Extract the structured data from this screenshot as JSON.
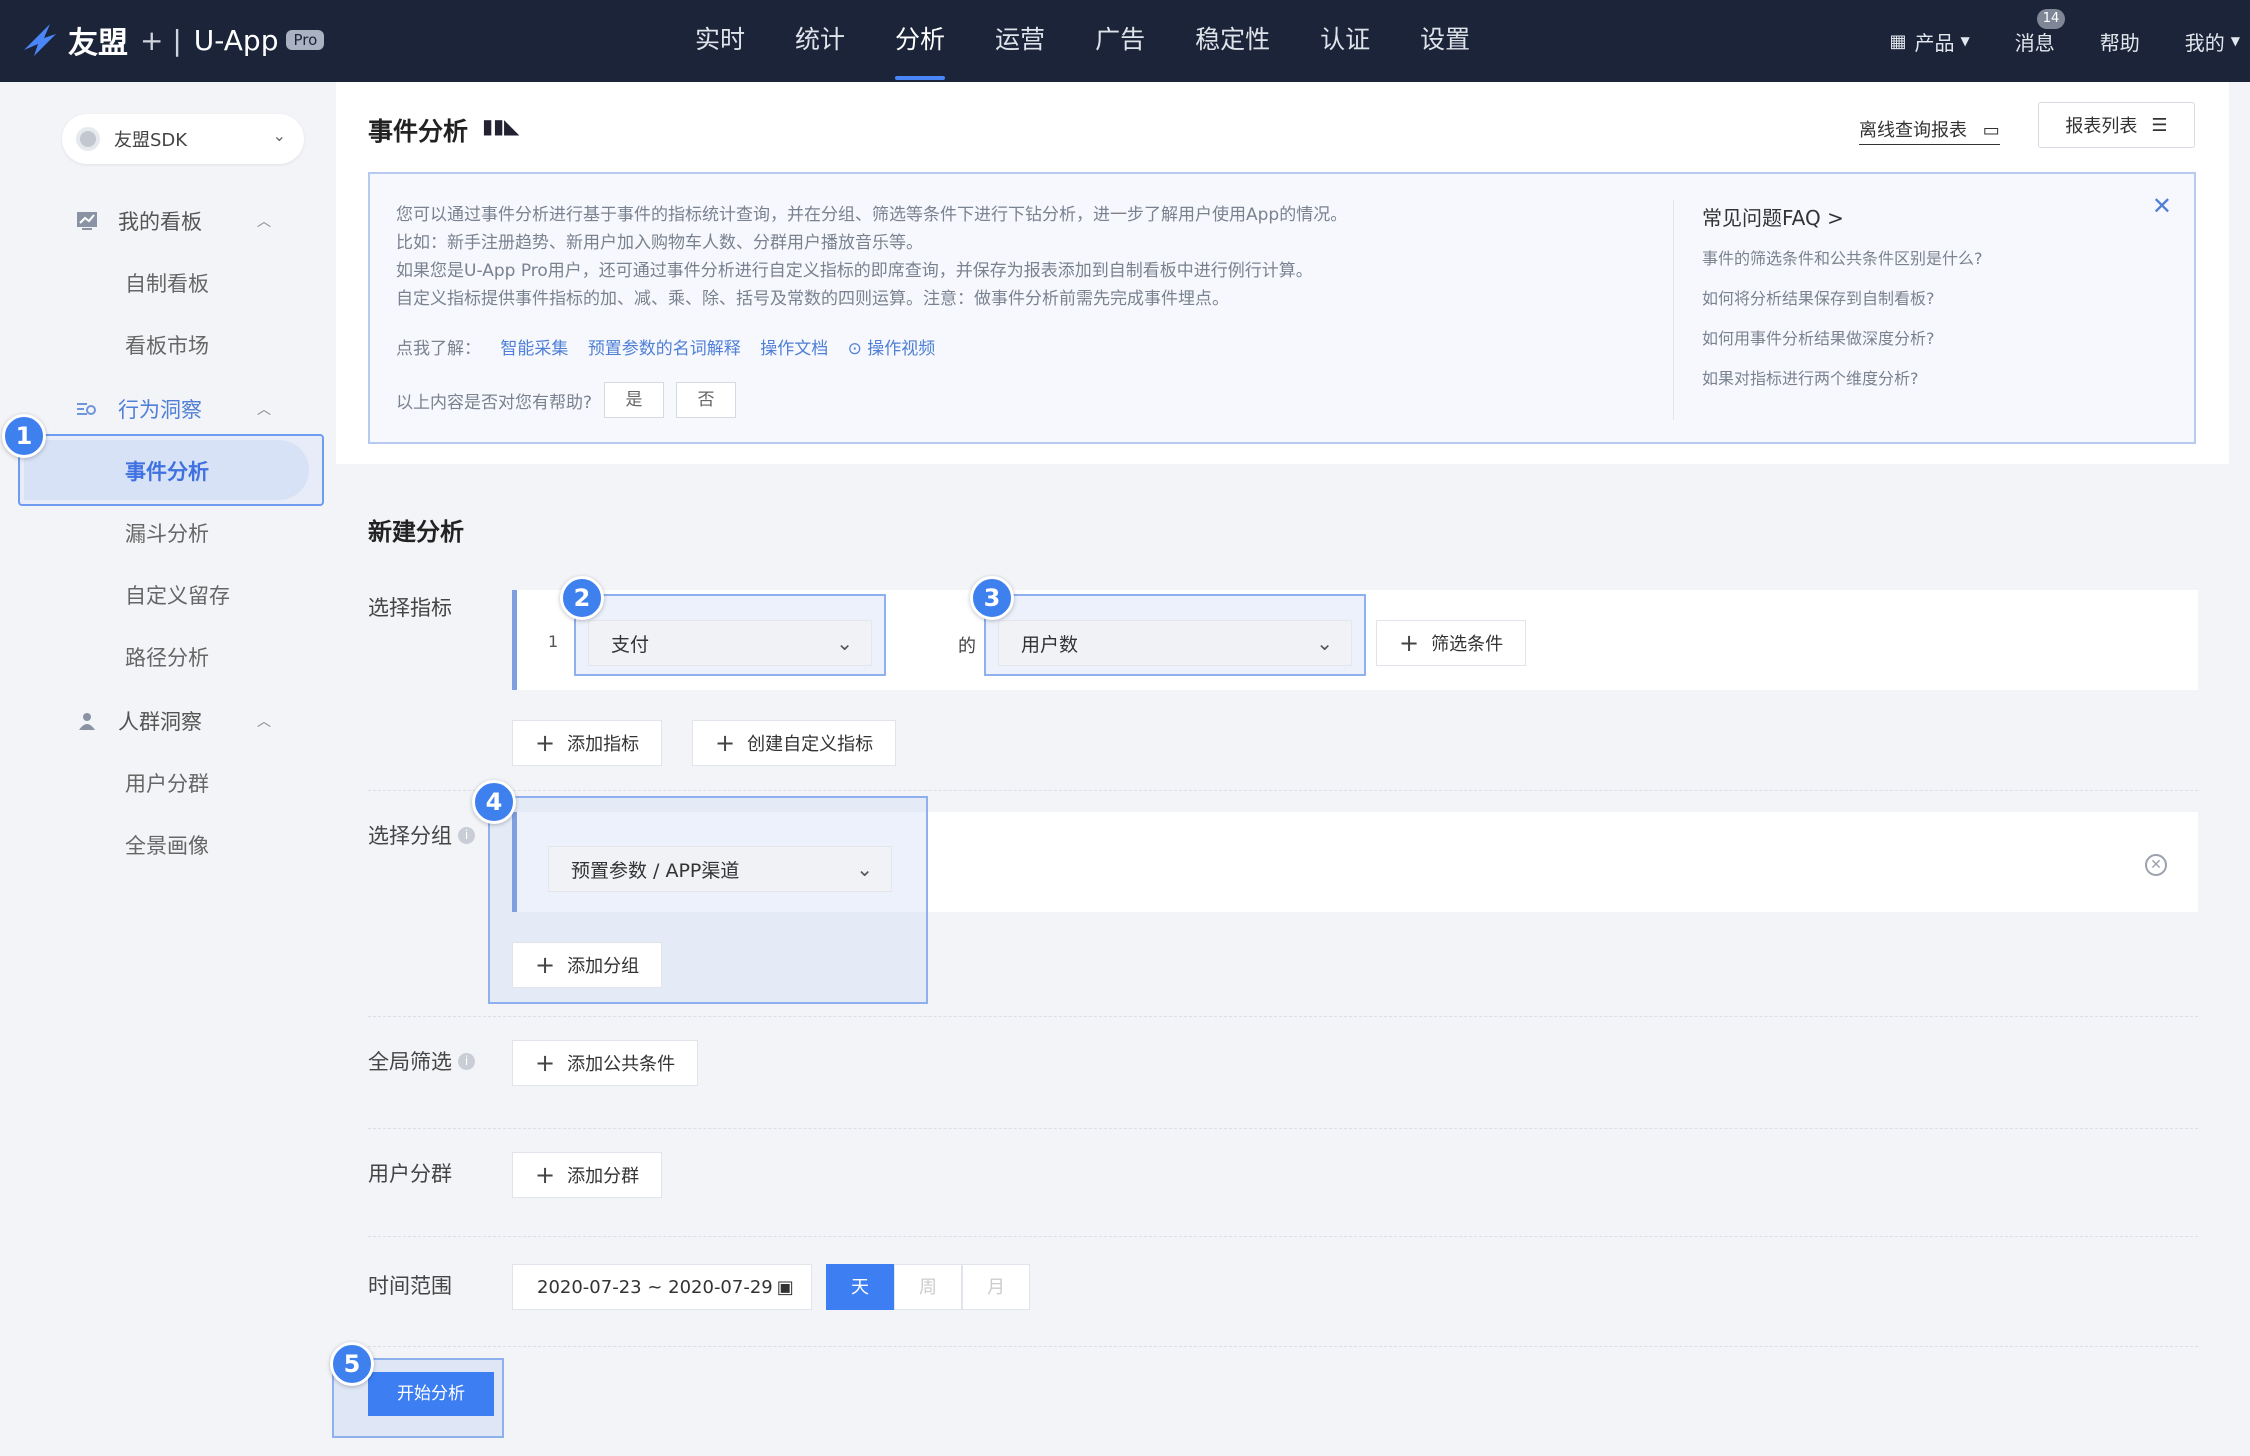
{
  "topnav": {
    "brand": "友盟",
    "sep": "+ |",
    "app": "U-App",
    "badge": "Pro",
    "items": [
      "实时",
      "统计",
      "分析",
      "运营",
      "广告",
      "稳定性",
      "认证",
      "设置"
    ],
    "active": "分析",
    "right": {
      "product": "产品",
      "messages": "消息",
      "messages_count": "14",
      "help": "帮助",
      "mine": "我的"
    }
  },
  "sidebar": {
    "sdk": "友盟SDK",
    "groups": [
      {
        "label": "我的看板",
        "items": [
          "自制看板",
          "看板市场"
        ]
      },
      {
        "label": "行为洞察",
        "items": [
          "事件分析",
          "漏斗分析",
          "自定义留存",
          "路径分析"
        ]
      },
      {
        "label": "人群洞察",
        "items": [
          "用户分群",
          "全景画像"
        ]
      }
    ],
    "active_item": "事件分析"
  },
  "header": {
    "title": "事件分析",
    "offline": "离线查询报表",
    "reports": "报表列表",
    "info_lines": [
      "您可以通过事件分析进行基于事件的指标统计查询，并在分组、筛选等条件下进行下钻分析，进一步了解用户使用App的情况。",
      "比如：新手注册趋势、新用户加入购物车人数、分群用户播放音乐等。",
      "如果您是U-App Pro用户，还可通过事件分析进行自定义指标的即席查询，并保存为报表添加到自制看板中进行例行计算。",
      "自定义指标提供事件指标的加、减、乘、除、括号及常数的四则运算。注意：做事件分析前需先完成事件埋点。"
    ],
    "links_prefix": "点我了解：",
    "links": [
      "智能采集",
      "预置参数的名词解释",
      "操作文档",
      "操作视频"
    ],
    "helpful_q": "以上内容是否对您有帮助?",
    "yes": "是",
    "no": "否",
    "faq_title": "常见问题FAQ >",
    "faq": [
      "事件的筛选条件和公共条件区别是什么?",
      "如何将分析结果保存到自制看板?",
      "如何用事件分析结果做深度分析?",
      "如果对指标进行两个维度分析?"
    ]
  },
  "form": {
    "title": "新建分析",
    "metric_label": "选择指标",
    "metric_index": "1",
    "event": "支付",
    "of": "的",
    "measure": "用户数",
    "filter": "筛选条件",
    "add_metric": "添加指标",
    "custom_metric": "创建自定义指标",
    "group_label": "选择分组",
    "group_value": "预置参数 / APP渠道",
    "add_group": "添加分组",
    "global_label": "全局筛选",
    "add_common": "添加公共条件",
    "segment_label": "用户分群",
    "add_segment": "添加分群",
    "time_label": "时间范围",
    "date_range": "2020-07-23 ~ 2020-07-29",
    "granularity": [
      "天",
      "周",
      "月"
    ],
    "granularity_selected": "天",
    "start": "开始分析"
  },
  "badges": [
    "1",
    "2",
    "3",
    "4",
    "5"
  ],
  "colors": {
    "topbar": "#1b2438",
    "accent": "#3d7ef3",
    "badge": "#3d80ee"
  }
}
